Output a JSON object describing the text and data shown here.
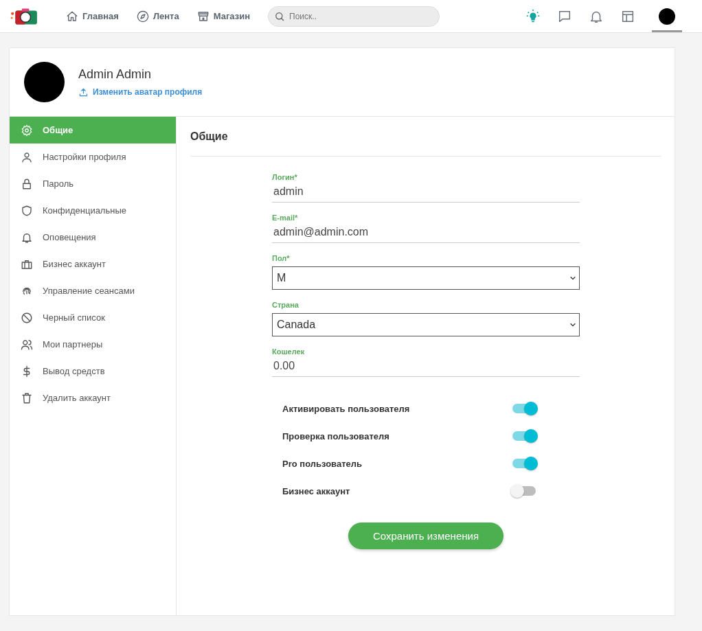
{
  "nav": [
    {
      "label": "Главная"
    },
    {
      "label": "Лента"
    },
    {
      "label": "Магазин"
    }
  ],
  "search": {
    "placeholder": "Поиск.."
  },
  "profile": {
    "name": "Admin Admin",
    "change_avatar": "Изменить аватар профиля"
  },
  "sidebar": {
    "items": [
      {
        "label": "Общие",
        "selected": true
      },
      {
        "label": "Настройки профиля",
        "selected": false
      },
      {
        "label": "Пароль",
        "selected": false
      },
      {
        "label": "Конфиденциальные",
        "selected": false
      },
      {
        "label": "Оповещения",
        "selected": false
      },
      {
        "label": "Бизнес аккаунт",
        "selected": false
      },
      {
        "label": "Управление сеансами",
        "selected": false
      },
      {
        "label": "Черный список",
        "selected": false
      },
      {
        "label": "Мои партнеры",
        "selected": false
      },
      {
        "label": "Вывод средств",
        "selected": false
      },
      {
        "label": "Удалить аккаунт",
        "selected": false
      }
    ]
  },
  "section_title": "Общие",
  "fields": [
    {
      "kind": "text",
      "label": "Логин*",
      "value": "admin"
    },
    {
      "kind": "text",
      "label": "E-mail*",
      "value": "admin@admin.com"
    },
    {
      "kind": "select",
      "label": "Пол*",
      "value": "M"
    },
    {
      "kind": "select",
      "label": "Страна",
      "value": "Canada"
    },
    {
      "kind": "text",
      "label": "Кошелек",
      "value": "0.00"
    }
  ],
  "toggles": [
    {
      "label": "Активировать пользователя",
      "on": true
    },
    {
      "label": "Проверка пользователя",
      "on": true
    },
    {
      "label": "Pro пользователь",
      "on": true
    },
    {
      "label": "Бизнес аккаунт",
      "on": false
    }
  ],
  "save_button": "Сохранить изменения"
}
